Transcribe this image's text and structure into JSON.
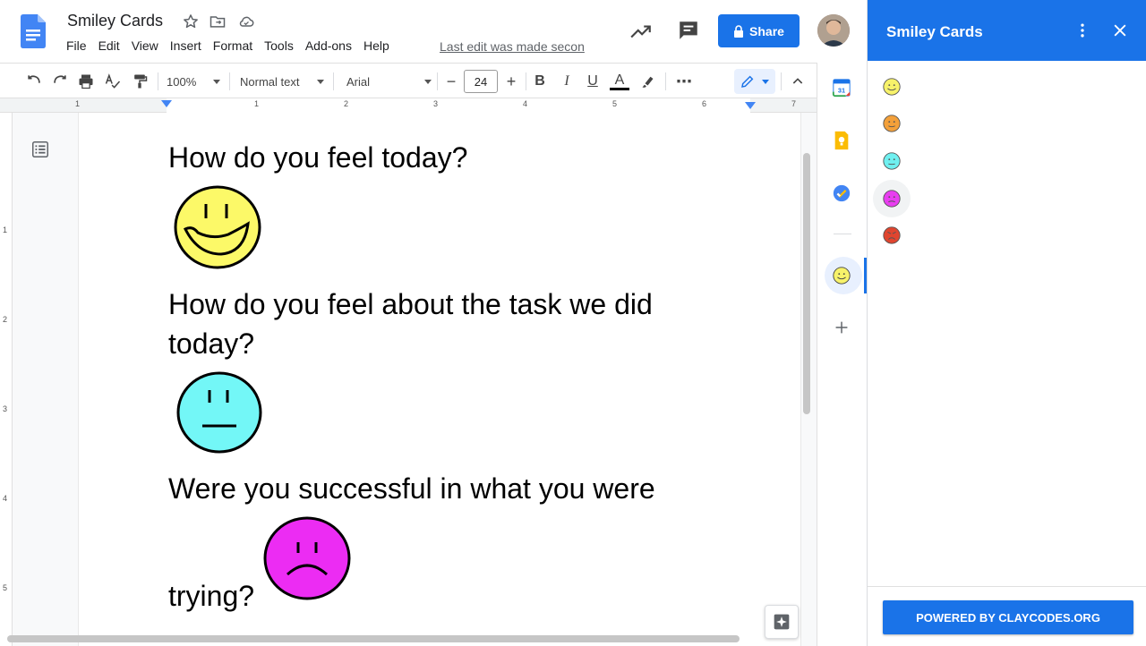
{
  "header": {
    "doc_title": "Smiley Cards",
    "menu": [
      "File",
      "Edit",
      "View",
      "Insert",
      "Format",
      "Tools",
      "Add-ons",
      "Help"
    ],
    "last_edit": "Last edit was made secon",
    "share_label": "Share",
    "icons": [
      "docs-logo",
      "star-icon",
      "move-to-folder-icon",
      "cloud-status-icon",
      "activity-trend-icon",
      "comment-icon",
      "lock-icon"
    ]
  },
  "toolbar": {
    "zoom": "100%",
    "style": "Normal text",
    "font": "Arial",
    "font_size": "24",
    "minus": "−",
    "plus": "+",
    "bold": "B",
    "italic": "I",
    "underline": "U",
    "text_color_letter": "A",
    "more": "⋯"
  },
  "ruler": {
    "numbers": [
      "1",
      "1",
      "2",
      "3",
      "4",
      "5",
      "6",
      "7"
    ],
    "vertical_numbers": [
      "1",
      "2",
      "3",
      "4",
      "5"
    ]
  },
  "document": {
    "q1": "How do you feel today?",
    "q2a": "How do you feel about the task we did",
    "q2b": "today?",
    "q3a": "Were you successful in what you were",
    "q3b": "trying?",
    "faces": [
      {
        "mood": "happy",
        "color": "#fcf968"
      },
      {
        "mood": "neutral",
        "color": "#73f7f7"
      },
      {
        "mood": "sad",
        "color": "#ec2cf3"
      }
    ]
  },
  "rail": {
    "icons": [
      "calendar-icon",
      "keep-icon",
      "tasks-icon",
      "smiley-cards-icon",
      "add-icon"
    ],
    "calendar_day": "31"
  },
  "sidebar": {
    "title": "Smiley Cards",
    "smileys": [
      {
        "mood": "happy",
        "color": "#f7f26a"
      },
      {
        "mood": "okay",
        "color": "#f3a03a"
      },
      {
        "mood": "neutral",
        "color": "#6ff0f0"
      },
      {
        "mood": "unhappy",
        "color": "#e83ef0"
      },
      {
        "mood": "angry",
        "color": "#e0452f"
      }
    ],
    "footer_button": "POWERED BY CLAYCODES.ORG"
  }
}
